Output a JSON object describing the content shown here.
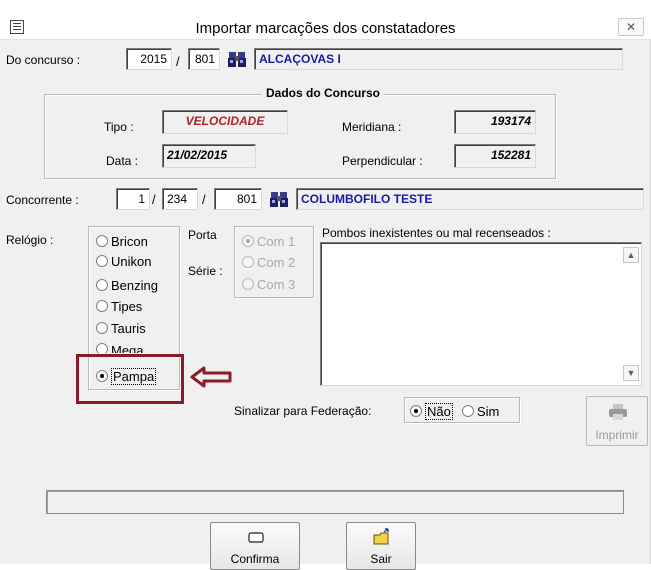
{
  "window": {
    "title": "Importar marcações dos constatadores",
    "close_glyph": "✕",
    "icon": "app-menu-icon"
  },
  "concurso": {
    "label": "Do concurso :",
    "year": "2015",
    "sep": "/",
    "code": "801",
    "name": "ALCAÇOVAS I",
    "search_icon": "binoculars-icon"
  },
  "dados": {
    "title": "Dados do Concurso",
    "tipo_label": "Tipo :",
    "tipo_value": "VELOCIDADE",
    "data_label": "Data :",
    "data_value": "21/02/2015",
    "meridiana_label": "Meridiana :",
    "meridiana_value": "193174",
    "perpendicular_label": "Perpendicular :",
    "perpendicular_value": "152281"
  },
  "concorrente": {
    "label": "Concorrente :",
    "num": "1",
    "sep1": "/",
    "code": "234",
    "sep2": "/",
    "num2": "801",
    "name": "COLUMBOFILO TESTE"
  },
  "relogio": {
    "label": "Relógio :",
    "options": [
      "Bricon",
      "Unikon",
      "Benzing",
      "Tipes",
      "Tauris",
      "Mega",
      "Pampa"
    ],
    "selected": "Pampa"
  },
  "porta": {
    "label": "Porta",
    "serie_label": "Série :",
    "options": [
      "Com 1",
      "Com 2",
      "Com 3"
    ],
    "selected": "Com 1"
  },
  "pombos": {
    "label": "Pombos inexistentes ou mal recenseados :"
  },
  "federacao": {
    "label": "Sinalizar para Federação:",
    "options": [
      "Não",
      "Sim"
    ],
    "selected": "Não"
  },
  "buttons": {
    "imprimir": "Imprimir",
    "confirma": "Confirma",
    "sair": "Sair"
  },
  "colors": {
    "highlight": "#8b1a2b",
    "field_blue": "#1a1aa0",
    "field_red": "#b22222"
  }
}
